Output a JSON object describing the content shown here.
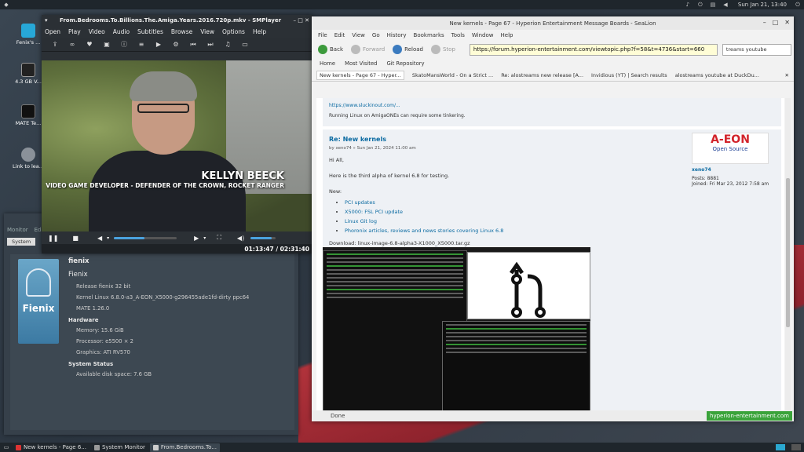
{
  "top_panel": {
    "clock": "Sun Jan 21, 13:40"
  },
  "desktop_icons": [
    "Fenix's ...",
    "4.3 GB V...",
    "MATE Te...",
    "Link to lea..."
  ],
  "smplayer": {
    "title": "From.Bedrooms.To.Billions.The.Amiga.Years.2016.720p.mkv - SMPlayer",
    "menu": [
      "Open",
      "Play",
      "Video",
      "Audio",
      "Subtitles",
      "Browse",
      "View",
      "Options",
      "Help"
    ],
    "lower_third_name": "KELLYN BEECK",
    "lower_third_role": "VIDEO GAME DEVELOPER - DEFENDER OF THE CROWN, ROCKET RANGER",
    "time": "01:13:47 / 02:31:40",
    "progress": 0.49,
    "volume": 0.85
  },
  "sysmon": {
    "tabs": [
      "Monitor",
      "Edit"
    ],
    "subtab": "System",
    "hostname": "fienix",
    "distro": "Fienix",
    "release": "Release fienix 32 bit",
    "kernel": "Kernel Linux 6.8.0-a3_A-EON_X5000-g296455ade1fd-dirty ppc64",
    "desktop": "MATE 1.26.0",
    "hardware_heading": "Hardware",
    "memory": "Memory:    15.6 GiB",
    "processor": "Processor:    e5500 × 2",
    "graphics": "Graphics:    ATI RV570",
    "status_heading": "System Status",
    "disk": "Available disk space:  7.6 GB",
    "logo_text": "Fienix"
  },
  "browser": {
    "title": "New kernels - Page 67 - Hyperion Entertainment Message Boards - SeaLion",
    "menu": [
      "File",
      "Edit",
      "View",
      "Go",
      "History",
      "Bookmarks",
      "Tools",
      "Window",
      "Help"
    ],
    "nav": {
      "back": "Back",
      "forward": "Forward",
      "reload": "Reload",
      "stop": "Stop"
    },
    "url": "https://forum.hyperion-entertainment.com/viewtopic.php?f=58&t=4736&start=660",
    "search": "treams youtube",
    "bookmarks": [
      "Home",
      "Most Visited",
      "Git Repository"
    ],
    "tabs": [
      "New kernels - Page 67 - Hyper...",
      "SkatoMansWorld - On a Strict ...",
      "Re: alostreams new release [A...",
      "Invidious (YT) | Search results",
      "alostreams youtube at DuckDu..."
    ],
    "post_top_link": "https://www.sluckinout.com/...",
    "post_top_text": "Running Linux on AmigaONEs can require some tinkering.",
    "post_title": "Re: New kernels",
    "post_by": "by xeno74 » Sun Jan 21, 2024 11:00 am",
    "greeting": "Hi All,",
    "intro": "Here is the third alpha of kernel 6.8 for testing.",
    "new_label": "New:",
    "list": [
      "PCI updates",
      "X5000: FSL PCI update",
      "Linux Git log",
      "Phoronix articles, reviews and news stories covering Linux 6.8"
    ],
    "download": "Download: linux-image-6.8-alpha3-X1000_X5000.tar.gz",
    "author": "xeno74",
    "posts": "Posts: 8881",
    "joined": "Joined: Fri Mar 23, 2012 7:58 am",
    "aeon": "A-EON",
    "aeon_sub": "Open Source",
    "status": "Done",
    "host": "hyperion-entertainment.com"
  },
  "taskbar": [
    "New kernels - Page 6...",
    "System Monitor",
    "From.Bedrooms.To..."
  ]
}
